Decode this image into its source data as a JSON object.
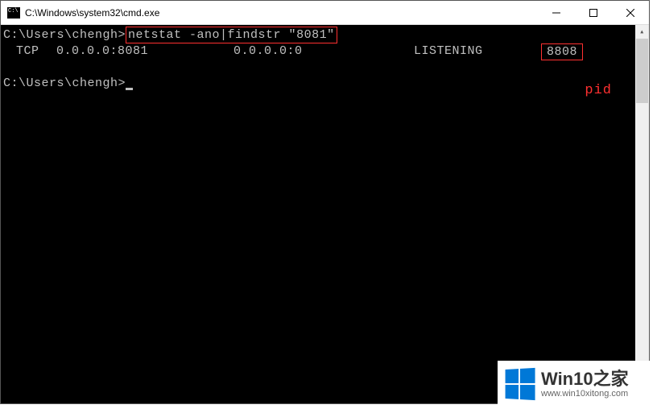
{
  "window": {
    "title": "C:\\Windows\\system32\\cmd.exe"
  },
  "terminal": {
    "prompt1": "C:\\Users\\chengh>",
    "command": "netstat -ano|findstr \"8081\"",
    "output": {
      "proto": "TCP",
      "local": "0.0.0.0:8081",
      "foreign": "0.0.0.0:0",
      "state": "LISTENING",
      "pid": "8808"
    },
    "prompt2": "C:\\Users\\chengh>"
  },
  "annotations": {
    "pid_label": "pid"
  },
  "watermark": {
    "title": "Win10之家",
    "url": "www.win10xitong.com"
  }
}
